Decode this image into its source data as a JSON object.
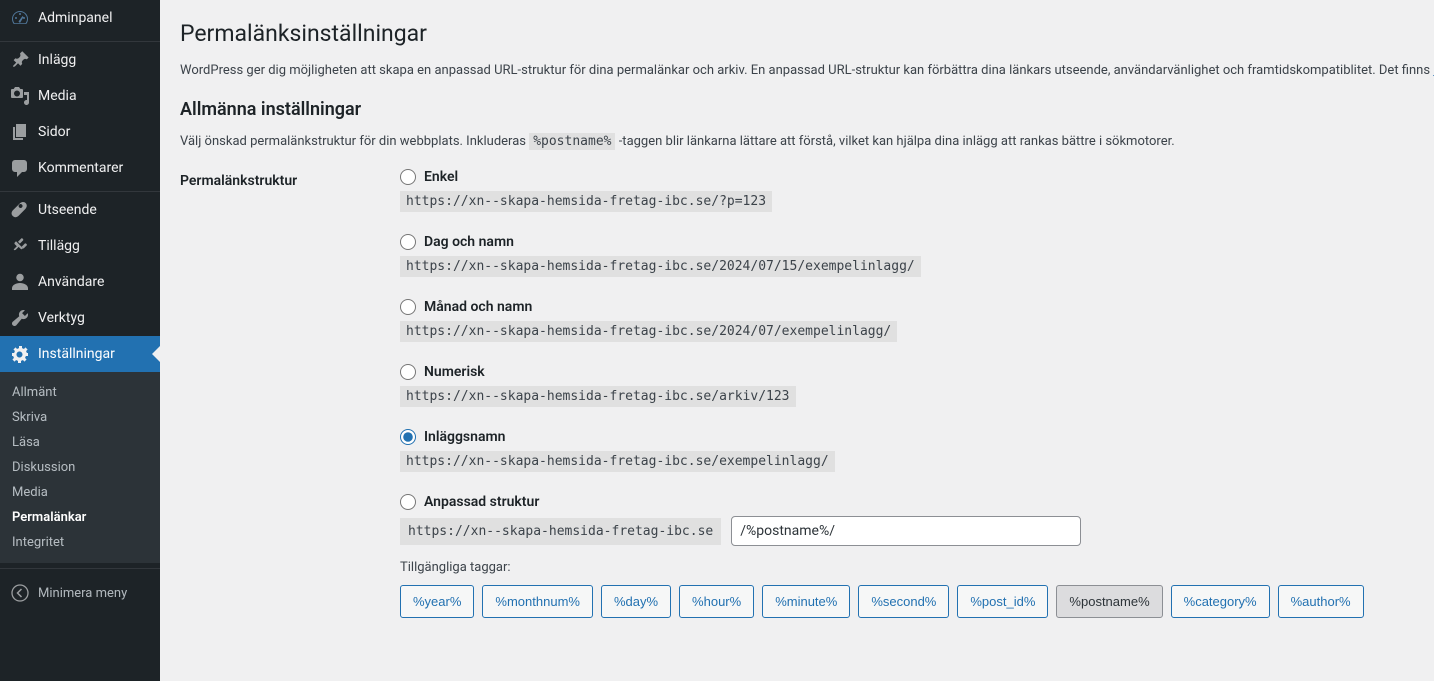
{
  "sidebar": {
    "items": [
      {
        "label": "Adminpanel"
      },
      {
        "label": "Inlägg"
      },
      {
        "label": "Media"
      },
      {
        "label": "Sidor"
      },
      {
        "label": "Kommentarer"
      },
      {
        "label": "Utseende"
      },
      {
        "label": "Tillägg"
      },
      {
        "label": "Användare"
      },
      {
        "label": "Verktyg"
      },
      {
        "label": "Inställningar"
      }
    ],
    "sub": [
      {
        "label": "Allmänt"
      },
      {
        "label": "Skriva"
      },
      {
        "label": "Läsa"
      },
      {
        "label": "Diskussion"
      },
      {
        "label": "Media"
      },
      {
        "label": "Permalänkar"
      },
      {
        "label": "Integritet"
      }
    ],
    "collapse": "Minimera meny"
  },
  "page": {
    "title": "Permalänksinställningar",
    "intro_prefix": "WordPress ger dig möjligheten att skapa en anpassad URL-struktur för dina permalänkar och arkiv. En anpassad URL-struktur kan förbättra dina länkars utseende, användarvänlighet och framtidskompatiblitet. Det finns ",
    "intro_link": "n",
    "section_heading": "Allmänna inställningar",
    "section_desc_before": "Välj önskad permalänkstruktur för din webbplats. Inkluderas ",
    "section_desc_code": "%postname%",
    "section_desc_after": " -taggen blir länkarna lättare att förstå, vilket kan hjälpa dina inlägg att rankas bättre i sökmotorer.",
    "structure_label": "Permalänkstruktur",
    "options": [
      {
        "label": "Enkel",
        "url": "https://xn--skapa-hemsida-fretag-ibc.se/?p=123"
      },
      {
        "label": "Dag och namn",
        "url": "https://xn--skapa-hemsida-fretag-ibc.se/2024/07/15/exempelinlagg/"
      },
      {
        "label": "Månad och namn",
        "url": "https://xn--skapa-hemsida-fretag-ibc.se/2024/07/exempelinlagg/"
      },
      {
        "label": "Numerisk",
        "url": "https://xn--skapa-hemsida-fretag-ibc.se/arkiv/123"
      },
      {
        "label": "Inläggsnamn",
        "url": "https://xn--skapa-hemsida-fretag-ibc.se/exempelinlagg/"
      },
      {
        "label": "Anpassad struktur"
      }
    ],
    "custom_base": "https://xn--skapa-hemsida-fretag-ibc.se",
    "custom_value": "/%postname%/",
    "tags_label": "Tillgängliga taggar:",
    "tags": [
      "%year%",
      "%monthnum%",
      "%day%",
      "%hour%",
      "%minute%",
      "%second%",
      "%post_id%",
      "%postname%",
      "%category%",
      "%author%"
    ]
  }
}
